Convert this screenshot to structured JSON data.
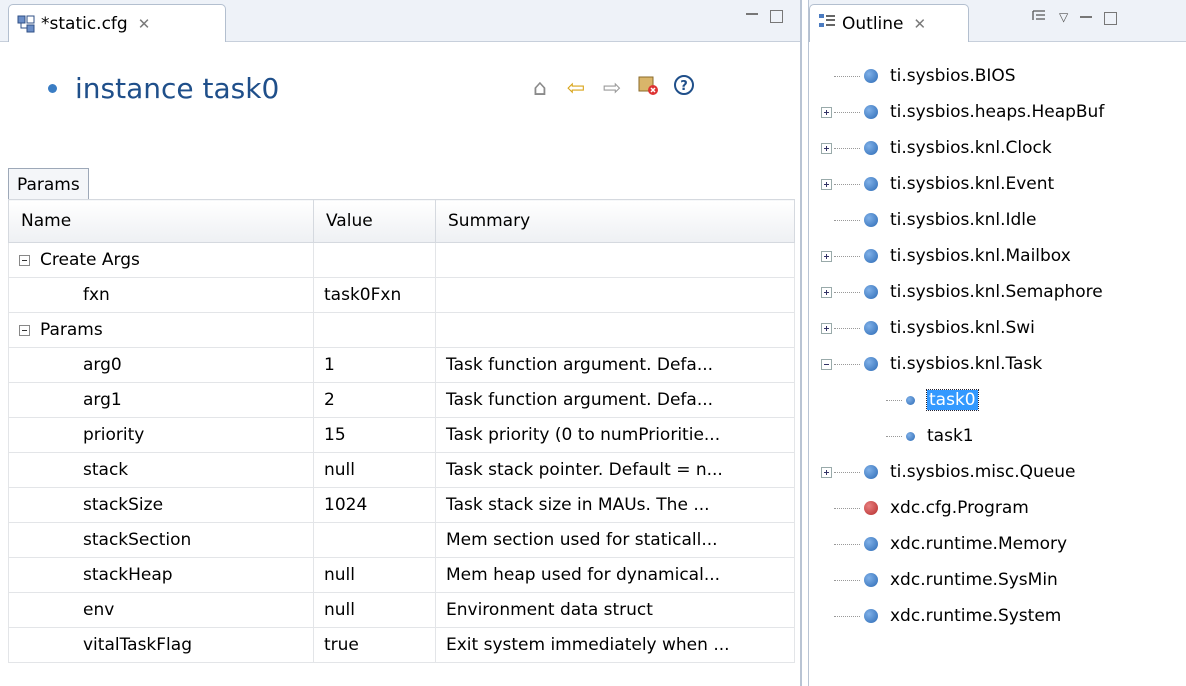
{
  "editor": {
    "tab_label": "*static.cfg",
    "title": "instance task0",
    "params_tab": "Params",
    "columns": [
      "Name",
      "Value",
      "Summary"
    ],
    "rows": [
      {
        "name": "Create Args",
        "value": "",
        "summary": "",
        "group": true
      },
      {
        "name": "fxn",
        "value": "task0Fxn",
        "summary": "",
        "group": false
      },
      {
        "name": "Params",
        "value": "",
        "summary": "",
        "group": true
      },
      {
        "name": "arg0",
        "value": "1",
        "summary": "Task function argument. Defa...",
        "group": false
      },
      {
        "name": "arg1",
        "value": "2",
        "summary": "Task function argument. Defa...",
        "group": false
      },
      {
        "name": "priority",
        "value": "15",
        "summary": "Task priority (0 to numPrioritie...",
        "group": false
      },
      {
        "name": "stack",
        "value": "null",
        "summary": "Task stack pointer. Default = n...",
        "group": false
      },
      {
        "name": "stackSize",
        "value": "1024",
        "summary": "Task stack size in MAUs.   The ...",
        "group": false
      },
      {
        "name": "stackSection",
        "value": "",
        "summary": "Mem section used for staticall...",
        "group": false
      },
      {
        "name": "stackHeap",
        "value": "null",
        "summary": "Mem heap used for dynamical...",
        "group": false
      },
      {
        "name": "env",
        "value": "null",
        "summary": "Environment data struct",
        "group": false
      },
      {
        "name": "vitalTaskFlag",
        "value": "true",
        "summary": "Exit system immediately when ...",
        "group": false
      }
    ]
  },
  "outline": {
    "tab_label": "Outline",
    "items": [
      {
        "label": "ti.sysbios.BIOS",
        "expander": "none",
        "color": "blue",
        "level": 0
      },
      {
        "label": "ti.sysbios.heaps.HeapBuf",
        "expander": "closed",
        "color": "blue",
        "level": 0
      },
      {
        "label": "ti.sysbios.knl.Clock",
        "expander": "closed",
        "color": "blue",
        "level": 0
      },
      {
        "label": "ti.sysbios.knl.Event",
        "expander": "closed",
        "color": "blue",
        "level": 0
      },
      {
        "label": "ti.sysbios.knl.Idle",
        "expander": "none",
        "color": "blue",
        "level": 0
      },
      {
        "label": "ti.sysbios.knl.Mailbox",
        "expander": "closed",
        "color": "blue",
        "level": 0
      },
      {
        "label": "ti.sysbios.knl.Semaphore",
        "expander": "closed",
        "color": "blue",
        "level": 0
      },
      {
        "label": "ti.sysbios.knl.Swi",
        "expander": "closed",
        "color": "blue",
        "level": 0
      },
      {
        "label": "ti.sysbios.knl.Task",
        "expander": "open",
        "color": "blue",
        "level": 0
      },
      {
        "label": "task0",
        "expander": "none",
        "color": "blue",
        "level": 1,
        "selected": true
      },
      {
        "label": "task1",
        "expander": "none",
        "color": "blue",
        "level": 1
      },
      {
        "label": "ti.sysbios.misc.Queue",
        "expander": "closed",
        "color": "blue",
        "level": 0
      },
      {
        "label": "xdc.cfg.Program",
        "expander": "none",
        "color": "red",
        "level": 0
      },
      {
        "label": "xdc.runtime.Memory",
        "expander": "none",
        "color": "blue",
        "level": 0
      },
      {
        "label": "xdc.runtime.SysMin",
        "expander": "none",
        "color": "blue",
        "level": 0
      },
      {
        "label": "xdc.runtime.System",
        "expander": "none",
        "color": "blue",
        "level": 0
      }
    ]
  },
  "icons": {
    "editor_tab": "config-file-icon",
    "outline_tab": "outline-icon",
    "home": "home-icon",
    "back": "back-arrow-icon",
    "forward": "forward-arrow-icon",
    "config": "config-error-icon",
    "help": "help-icon"
  }
}
